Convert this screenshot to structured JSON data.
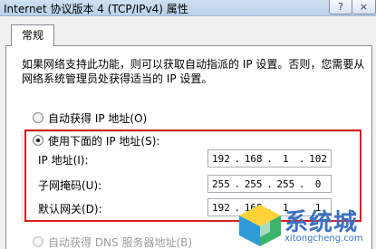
{
  "window": {
    "title": "Internet 协议版本 4 (TCP/IPv4) 属性",
    "help_glyph": "?",
    "close_glyph": "×"
  },
  "tabs": [
    {
      "label": "常规"
    }
  ],
  "description": "如果网络支持此功能，则可以获取自动指派的 IP 设置。否则，您需要从网络系统管理员处获得适当的 IP 设置。",
  "radios": {
    "auto_ip": {
      "label": "自动获得 IP 地址(O)",
      "checked": false
    },
    "manual_ip": {
      "label": "使用下面的 IP 地址(S):",
      "checked": true
    },
    "auto_dns": {
      "label": "自动获得 DNS 服务器地址(B)",
      "checked": false
    }
  },
  "fields": {
    "ip_address": {
      "label": "IP 地址(I):",
      "octets": [
        "192",
        "168",
        "1",
        "102"
      ]
    },
    "subnet_mask": {
      "label": "子网掩码(U):",
      "octets": [
        "255",
        "255",
        "255",
        "0"
      ]
    },
    "default_gateway": {
      "label": "默认网关(D):",
      "octets": [
        "192",
        "168",
        "1",
        "1"
      ]
    }
  },
  "watermark": {
    "text": "系统城",
    "url": "xitongcheng.com"
  },
  "colors": {
    "highlight": "#d62020",
    "watermark": "#3a72c4",
    "titlebar": "#b9d1ea"
  }
}
